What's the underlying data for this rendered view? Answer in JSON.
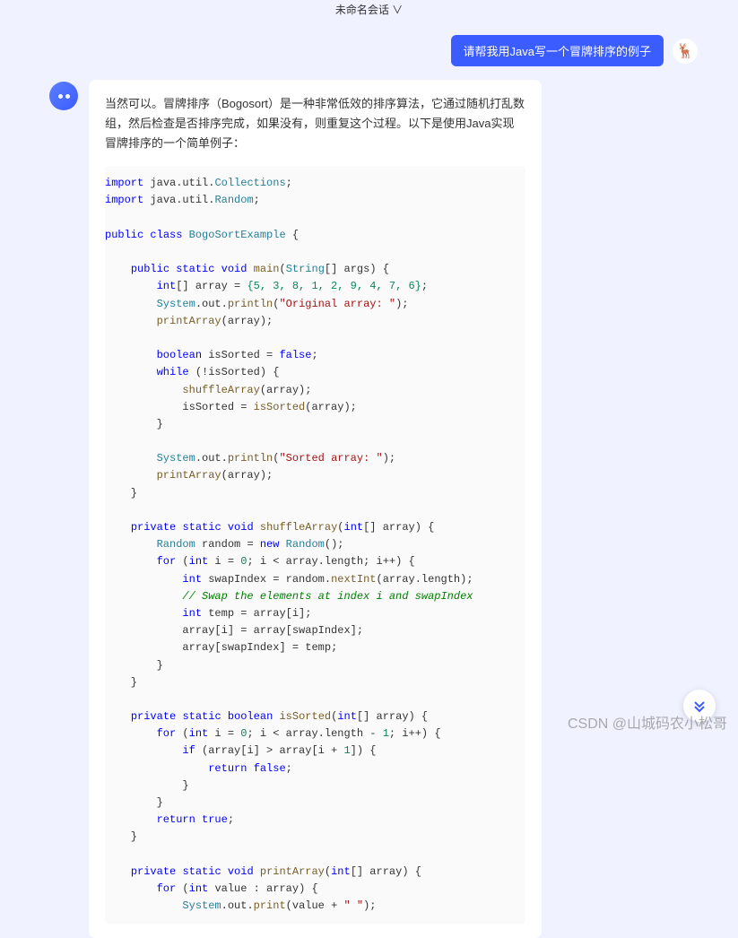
{
  "header": {
    "title": "未命名会话 ∨"
  },
  "user": {
    "message": "请帮我用Java写一个冒牌排序的例子",
    "avatar_emoji": "🦌"
  },
  "ai": {
    "intro": "当然可以。冒牌排序（Bogosort）是一种非常低效的排序算法，它通过随机打乱数组，然后检查是否排序完成，如果没有，则重复这个过程。以下是使用Java实现冒牌排序的一个简单例子：",
    "code_kw_import": "import",
    "code_kw_public": "public",
    "code_kw_class": "class",
    "code_kw_static": "static",
    "code_kw_void": "void",
    "code_kw_private": "private",
    "code_kw_new": "new",
    "code_kw_int": "int",
    "code_kw_boolean": "boolean",
    "code_kw_for": "for",
    "code_kw_while": "while",
    "code_kw_if": "if",
    "code_kw_return": "return",
    "code_lit_false": "false",
    "code_lit_true": "true",
    "code_cls_String": "String",
    "code_cls_System": "System",
    "code_cls_Random": "Random",
    "code_cls_Collections": "Collections",
    "code_cls_BogoSort": "BogoSortExample",
    "code_fn_main": "main",
    "code_fn_println": "println",
    "code_fn_print": "print",
    "code_fn_printArray": "printArray",
    "code_fn_shuffleArray": "shuffleArray",
    "code_fn_isSorted": "isSorted",
    "code_fn_nextInt": "nextInt",
    "code_str_orig": "\"Original array: \"",
    "code_str_sorted": "\"Sorted array: \"",
    "code_str_space": "\" \"",
    "code_cmt_swap": "// Swap the elements at index i and swapIndex",
    "code_pkg_util": "java.util.",
    "code_arr_vals": "{5, 3, 8, 1, 2, 9, 4, 7, 6}",
    "code_n0": "0",
    "code_n1": "1",
    "code_txt_out": ".out.",
    "code_txt_args": "[] args) {",
    "code_txt_array_decl": "[] array = ",
    "code_txt_array_param": "[] array) {",
    "code_txt_array": "(array);",
    "code_txt_array_len": "array.length",
    "code_txt_issorted_var": "isSorted",
    "code_txt_random_var": "random",
    "code_txt_swapidx": "swapIndex",
    "code_txt_temp": "temp",
    "code_txt_value": "value"
  },
  "watermark": "CSDN @山城码农小松哥"
}
